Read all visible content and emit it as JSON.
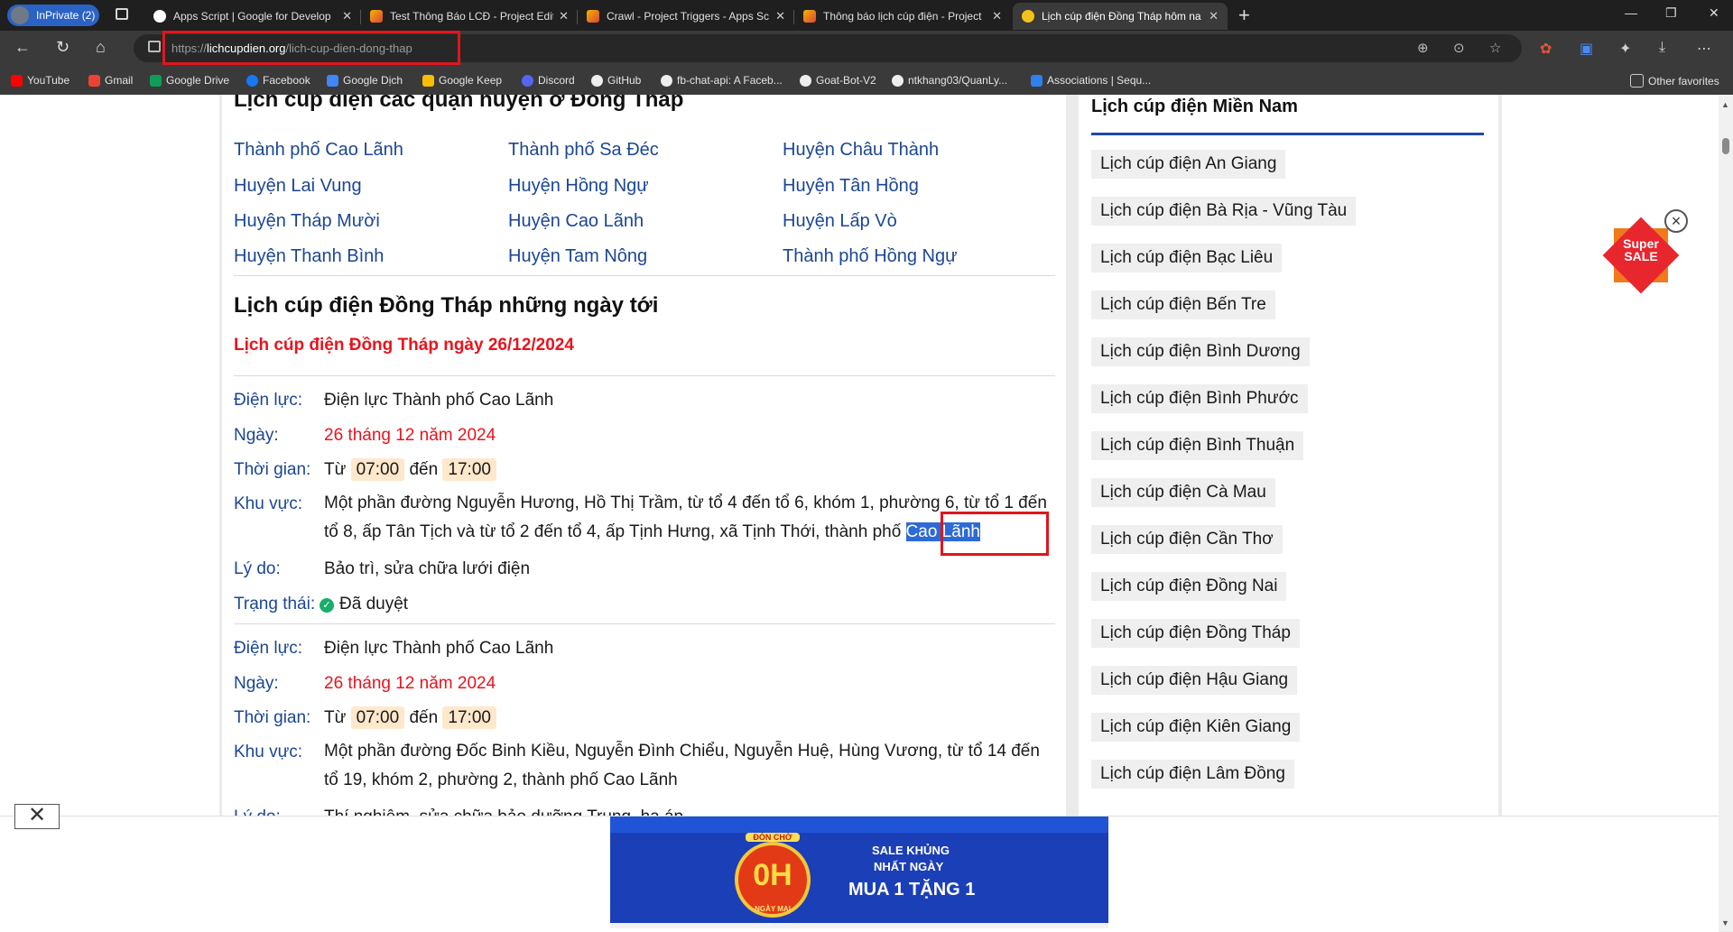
{
  "browser": {
    "inprivate_label": "InPrivate (2)",
    "tabs": [
      {
        "title": "Apps Script | Google for Develop",
        "active": false
      },
      {
        "title": "Test Thông Báo LCĐ - Project Edit",
        "active": false
      },
      {
        "title": "Crawl - Project Triggers - Apps Sc",
        "active": false
      },
      {
        "title": "Thông báo lịch cúp điện - Project",
        "active": false
      },
      {
        "title": "Lịch cúp điện Đồng Tháp hôm na",
        "active": true
      }
    ],
    "url_prefix": "https://",
    "url_domain": "lichcupdien.org",
    "url_path": "/lich-cup-dien-dong-thap",
    "bookmarks": [
      "YouTube",
      "Gmail",
      "Google Drive",
      "Facebook",
      "Google Dịch",
      "Google Keep",
      "Discord",
      "GitHub",
      "fb-chat-api: A Faceb...",
      "Goat-Bot-V2",
      "ntkhang03/QuanLy...",
      "Associations | Sequ..."
    ],
    "other_favorites": "Other favorites"
  },
  "districts": {
    "heading": "Lịch cúp điện các quận huyện ở Đồng Tháp",
    "links": [
      "Thành phố Cao Lãnh",
      "Thành phố Sa Đéc",
      "Huyện Châu Thành",
      "Huyện Lai Vung",
      "Huyện Hồng Ngự",
      "Huyện Tân Hồng",
      "Huyện Tháp Mười",
      "Huyện Cao Lãnh",
      "Huyện Lấp Vò",
      "Huyện Thanh Bình",
      "Huyện Tam Nông",
      "Thành phố Hồng Ngự"
    ]
  },
  "schedule": {
    "heading": "Lịch cúp điện Đồng Tháp những ngày tới",
    "date_heading": "Lịch cúp điện Đồng Tháp ngày 26/12/2024",
    "labels": {
      "dienluc": "Điện lực:",
      "ngay": "Ngày:",
      "thoigian": "Thời gian:",
      "khuvuc": "Khu vực:",
      "lydo": "Lý do:",
      "trangthai": "Trạng thái:",
      "tu": "Từ",
      "den": "đến"
    },
    "entries": [
      {
        "dienluc": "Điện lực Thành phố Cao Lãnh",
        "ngay": "26 tháng 12 năm 2024",
        "start": "07:00",
        "end": "17:00",
        "khuvuc_main": "Một phần đường Nguyễn Hương, Hồ Thị Trầm, từ tổ 4 đến tổ 6, khóm 1, phường 6, từ tổ 1 đến tổ 8, ấp Tân Tịch và từ tổ 2 đến tổ 4, ấp Tịnh Hưng, xã Tịnh Thới, thành phố",
        "khuvuc_selected": "Cao Lãnh",
        "lydo": "Bảo trì, sửa chữa lưới điện",
        "trangthai": "Đã duyệt"
      },
      {
        "dienluc": "Điện lực Thành phố Cao Lãnh",
        "ngay": "26 tháng 12 năm 2024",
        "start": "07:00",
        "end": "17:00",
        "khuvuc_main": "Một phần đường Đốc Binh Kiều, Nguyễn Đình Chiểu, Nguyễn Huệ, Hùng Vương, từ tổ 14 đến tổ 19, khóm 2, phường 2, thành phố Cao Lãnh",
        "lydo_partial": "Thí nghiệm, sửa chữa bảo dưỡng Trung, hạ áp"
      }
    ]
  },
  "sidebar": {
    "heading": "Lịch cúp điện Miền Nam",
    "items": [
      "Lịch cúp điện An Giang",
      "Lịch cúp điện Bà Rịa - Vũng Tàu",
      "Lịch cúp điện Bạc Liêu",
      "Lịch cúp điện Bến Tre",
      "Lịch cúp điện Bình Dương",
      "Lịch cúp điện Bình Phước",
      "Lịch cúp điện Bình Thuận",
      "Lịch cúp điện Cà Mau",
      "Lịch cúp điện Cần Thơ",
      "Lịch cúp điện Đồng Nai",
      "Lịch cúp điện Đồng Tháp",
      "Lịch cúp điện Hậu Giang",
      "Lịch cúp điện Kiên Giang",
      "Lịch cúp điện Lâm Đồng"
    ]
  },
  "promo": {
    "line1": "Super",
    "line2": "SALE"
  },
  "ad": {
    "badge": "ĐÓN CHỜ",
    "big": "0H",
    "sub": "NGÀY MAI",
    "line1": "SALE KHỦNG",
    "line2": "NHẤT NGÀY",
    "line3": "MUA 1 TẶNG 1"
  },
  "colors": {
    "link": "#1b4694",
    "red": "#e8141e",
    "accent": "#1b4aa6",
    "time_bg": "#ffe8cc"
  }
}
